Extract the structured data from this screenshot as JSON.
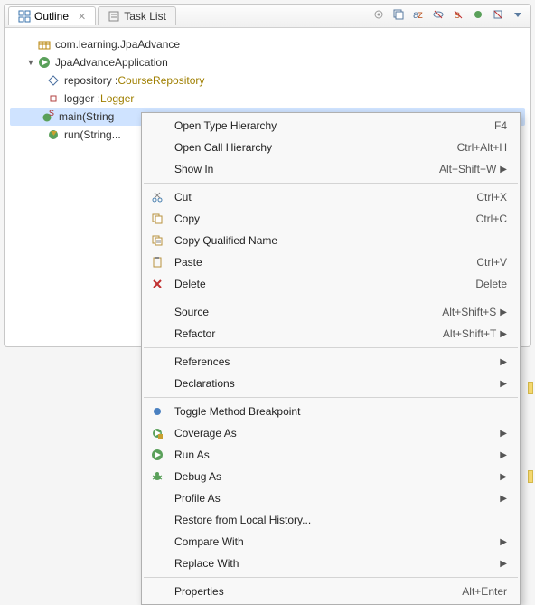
{
  "tabs": {
    "outline": "Outline",
    "tasklist": "Task List"
  },
  "tree": {
    "pkg": "com.learning.JpaAdvance",
    "cls": "JpaAdvanceApplication",
    "field_repo_name": "repository : ",
    "field_repo_type": "CourseRepository",
    "field_logger_name": "logger : ",
    "field_logger_type": "Logger",
    "method_main": "main(String",
    "method_run": "run(String..."
  },
  "menu": {
    "open_type_hierarchy": "Open Type Hierarchy",
    "open_call_hierarchy": "Open Call Hierarchy",
    "show_in": "Show In",
    "cut": "Cut",
    "copy": "Copy",
    "copy_qualified": "Copy Qualified Name",
    "paste": "Paste",
    "delete": "Delete",
    "source": "Source",
    "refactor": "Refactor",
    "references": "References",
    "declarations": "Declarations",
    "toggle_breakpoint": "Toggle Method Breakpoint",
    "coverage_as": "Coverage As",
    "run_as": "Run As",
    "debug_as": "Debug As",
    "profile_as": "Profile As",
    "restore_history": "Restore from Local History...",
    "compare_with": "Compare With",
    "replace_with": "Replace With",
    "properties": "Properties"
  },
  "shortcuts": {
    "f4": "F4",
    "ctrl_alt_h": "Ctrl+Alt+H",
    "alt_shift_w": "Alt+Shift+W",
    "ctrl_x": "Ctrl+X",
    "ctrl_c": "Ctrl+C",
    "ctrl_v": "Ctrl+V",
    "delete": "Delete",
    "alt_shift_s": "Alt+Shift+S",
    "alt_shift_t": "Alt+Shift+T",
    "alt_enter": "Alt+Enter"
  }
}
